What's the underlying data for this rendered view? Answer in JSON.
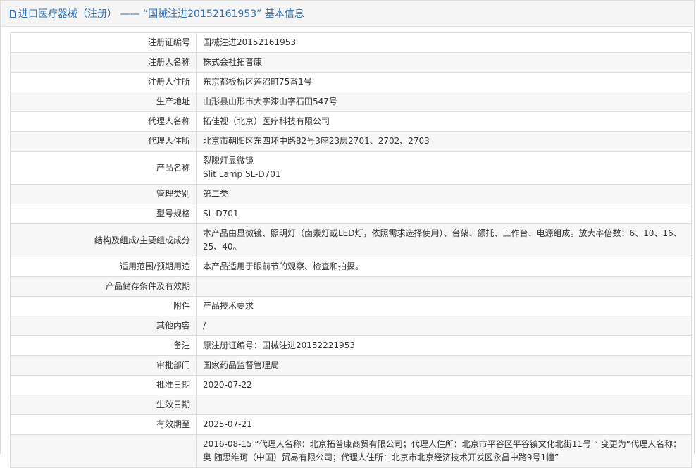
{
  "header": {
    "title": "进口医疗器械（注册） —— “国械注进20152161953” 基本信息"
  },
  "rows": [
    {
      "label": "注册证编号",
      "value": "国械注进20152161953"
    },
    {
      "label": "注册人名称",
      "value": "株式会社拓普康"
    },
    {
      "label": "注册人住所",
      "value": "东京都板桥区莲沼町75番1号"
    },
    {
      "label": "生产地址",
      "value": "山形县山形市大字漆山字石田547号"
    },
    {
      "label": "代理人名称",
      "value": "拓佳视（北京）医疗科技有限公司"
    },
    {
      "label": "代理人住所",
      "value": "北京市朝阳区东四环中路82号3座23层2701、2702、2703"
    },
    {
      "label": "产品名称",
      "value": "裂隙灯显微镜\nSlit Lamp SL-D701"
    },
    {
      "label": "管理类别",
      "value": "第二类"
    },
    {
      "label": "型号规格",
      "value": "SL-D701"
    },
    {
      "label": "结构及组成/主要组成成分",
      "value": "本产品由显微镜、照明灯（卤素灯或LED灯，依照需求选择使用）、台架、颌托、工作台、电源组成。放大率倍数：6、10、16、25、40。"
    },
    {
      "label": "适用范围/预期用途",
      "value": "本产品适用于眼前节的观察、检查和拍摄。"
    },
    {
      "label": "产品储存条件及有效期",
      "value": ""
    },
    {
      "label": "附件",
      "value": "产品技术要求"
    },
    {
      "label": "其他内容",
      "value": "/"
    },
    {
      "label": "备注",
      "value": "原注册证编号：国械注进20152221953"
    },
    {
      "label": "审批部门",
      "value": "国家药品监督管理局"
    },
    {
      "label": "批准日期",
      "value": "2020-07-22"
    },
    {
      "label": "生效日期",
      "value": ""
    },
    {
      "label": "有效期至",
      "value": "2025-07-21"
    },
    {
      "label": "",
      "value": "2016-08-15 “代理人名称：北京拓普康商贸有限公司；代理人住所：北京市平谷区平谷镇文化北街11号 ” 变更为“代理人名称：奥 随思维珂（中国）贸易有限公司；代理人住所：北京市北京经济技术开发区永昌中路9号1幢”"
    }
  ]
}
